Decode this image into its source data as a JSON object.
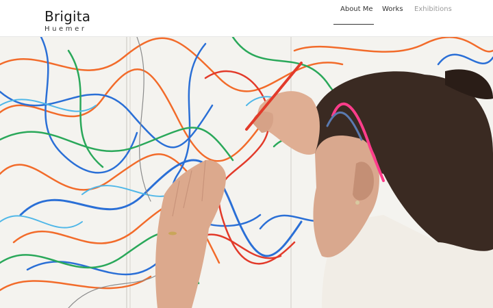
{
  "site": {
    "name": "Brigita",
    "surname": "Huemer"
  },
  "nav": {
    "items": [
      {
        "label": "About Me",
        "active": true
      },
      {
        "label": "Works",
        "active": false
      },
      {
        "label": "Exhibitions",
        "active": false
      }
    ]
  },
  "colors": {
    "accent": "#333333",
    "inactive_nav": "#9a9a9a",
    "line_orange": "#f26b2a",
    "line_blue": "#2a6fd6",
    "line_green": "#2aa85a",
    "line_red": "#e23a2a",
    "line_cyan": "#4fb7e8",
    "glasses_pink": "#ff3d8b"
  }
}
